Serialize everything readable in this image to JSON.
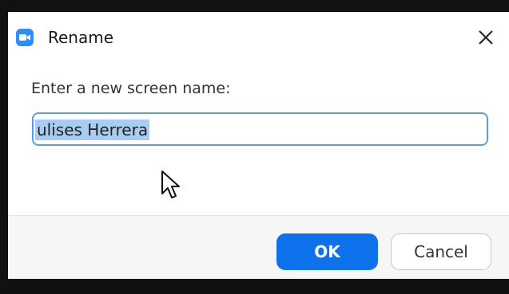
{
  "dialog": {
    "title": "Rename",
    "app_icon": "zoom-video-icon",
    "close_icon": "close-icon",
    "prompt": "Enter a new screen name:",
    "input_value": "ulises Herrera",
    "input_selected": true,
    "ok_label": "OK",
    "cancel_label": "Cancel"
  },
  "colors": {
    "accent": "#0e72ed",
    "app_icon_bg": "#2D8CFF",
    "input_border": "#5b9ee8",
    "selection": "#a9cdf2",
    "footer_bg": "#f6f6f6"
  }
}
